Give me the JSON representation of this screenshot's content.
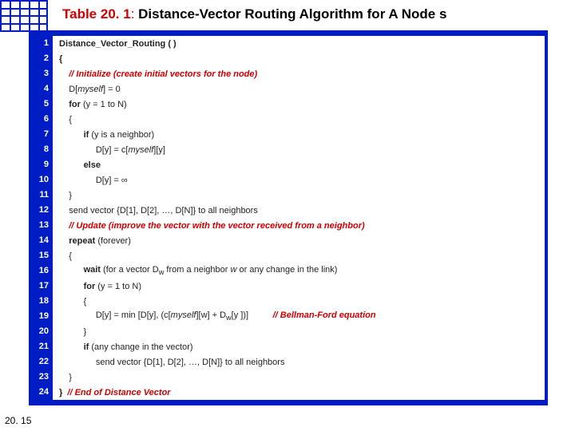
{
  "title": {
    "label": "Table 20. 1",
    "sep": ": ",
    "sub": "Distance-Vector Routing Algorithm for A Node  s"
  },
  "slide_number": "20. 15",
  "algo": {
    "lines": [
      {
        "n": "1",
        "html": "<span class='kw'>Distance_Vector_Routing ( )</span>"
      },
      {
        "n": "2",
        "html": "<span class='kw'>{</span>"
      },
      {
        "n": "3",
        "html": "    <span class='cmt'>// Initialize (create initial vectors for the node)</span>"
      },
      {
        "n": "4",
        "html": "    D[<span class='it'>myself</span>] = 0"
      },
      {
        "n": "5",
        "html": "    <span class='kw'>for</span> (y = 1 to N)"
      },
      {
        "n": "6",
        "html": "    {"
      },
      {
        "n": "7",
        "html": "          <span class='kw'>if</span> (y is a neighbor)"
      },
      {
        "n": "8",
        "html": "               D[y] = c[<span class='it'>myself</span>][y]"
      },
      {
        "n": "9",
        "html": "          <span class='kw'>else</span>"
      },
      {
        "n": "10",
        "html": "               D[y] = ∞"
      },
      {
        "n": "11",
        "html": "    }"
      },
      {
        "n": "12",
        "html": "    send vector {D[1], D[2], …, D[N]} to all neighbors"
      },
      {
        "n": "13",
        "html": "    <span class='cmt'>// Update (improve the vector with the vector received from a neighbor)</span>"
      },
      {
        "n": "14",
        "html": "    <span class='kw'>repeat</span> (forever)"
      },
      {
        "n": "15",
        "html": "    {"
      },
      {
        "n": "16",
        "html": "          <span class='kw'>wait</span> (for a vector D<sub>w</sub> from a neighbor <span class='it'>w</span> or any change in the link)"
      },
      {
        "n": "17",
        "html": "          <span class='kw'>for</span> (y = 1 to N)"
      },
      {
        "n": "18",
        "html": "          {"
      },
      {
        "n": "19",
        "html": "               D[y] = min [D[y], (c[<span class='it'>myself</span>][w] + D<sub>w</sub>[y ])]          <span class='bf'>// Bellman-Ford equation</span>"
      },
      {
        "n": "20",
        "html": "          }"
      },
      {
        "n": "21",
        "html": "          <span class='kw'>if</span> (any change in the vector)"
      },
      {
        "n": "22",
        "html": "               send vector {D[1], D[2], …, D[N]} to all neighbors"
      },
      {
        "n": "23",
        "html": "    }"
      },
      {
        "n": "24",
        "html": "<span class='kw'>}</span>  <span class='cmt2'>// End of Distance Vector</span>"
      }
    ]
  }
}
